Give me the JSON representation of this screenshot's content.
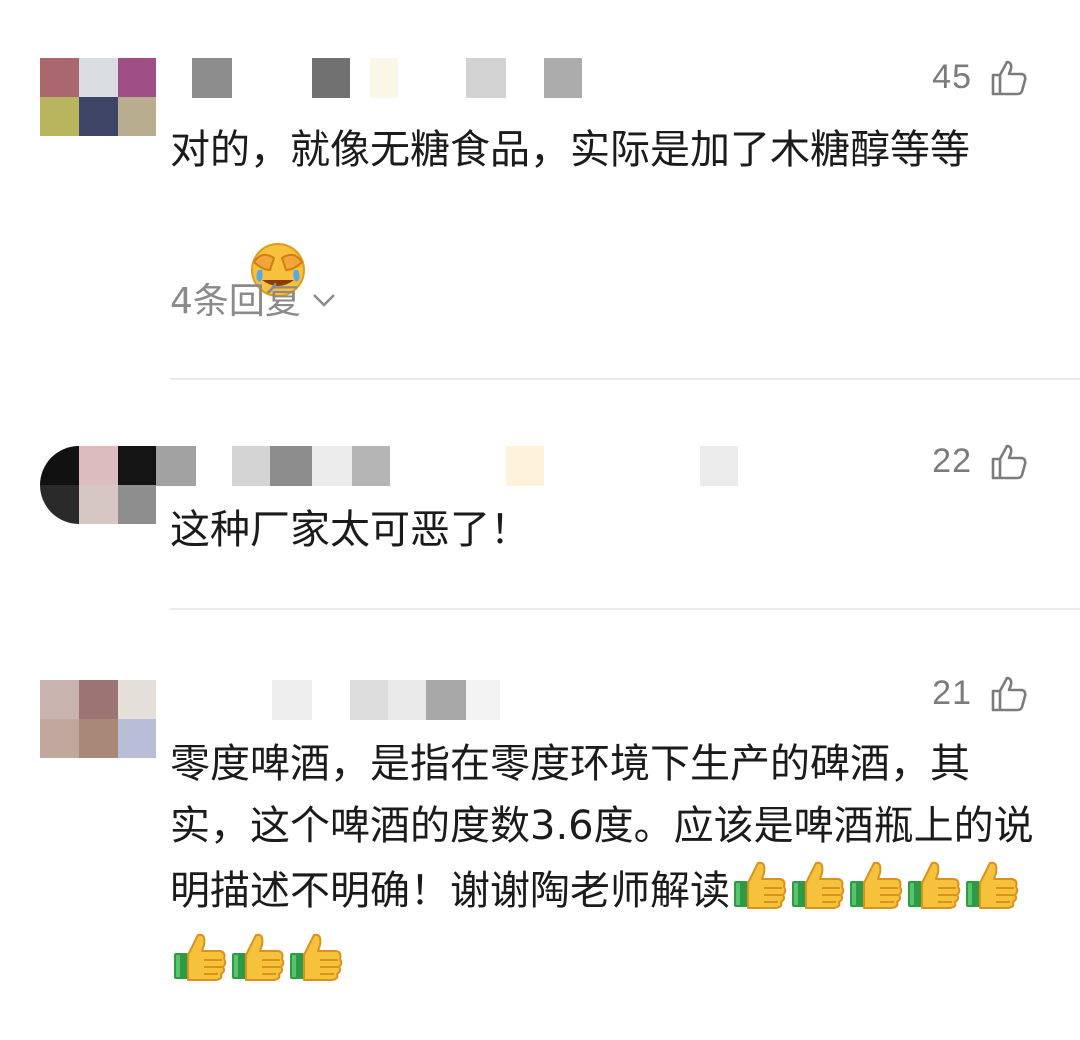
{
  "comments": [
    {
      "likes": "45",
      "text": "对的，就像无糖食品，实际是加了木糖醇等等",
      "replies": "4条回复",
      "emojis": [
        "face-palm-laughing-emoji"
      ]
    },
    {
      "likes": "22",
      "text": "这种厂家太可恶了！",
      "emojis": []
    },
    {
      "likes": "21",
      "text": "零度啤酒，是指在零度环境下生产的碑酒，其实，这个啤酒的度数3.6度。应该是啤酒瓶上的说明描述不明确！谢谢陶老师解读",
      "emojis": [
        "thumbs-up-emoji",
        "thumbs-up-emoji",
        "thumbs-up-emoji",
        "thumbs-up-emoji",
        "thumbs-up-emoji",
        "thumbs-up-emoji",
        "thumbs-up-emoji",
        "thumbs-up-emoji"
      ]
    }
  ],
  "colors": {
    "text": "#1b1b1b",
    "muted": "#7b7b7b",
    "divider": "#ebebeb"
  }
}
